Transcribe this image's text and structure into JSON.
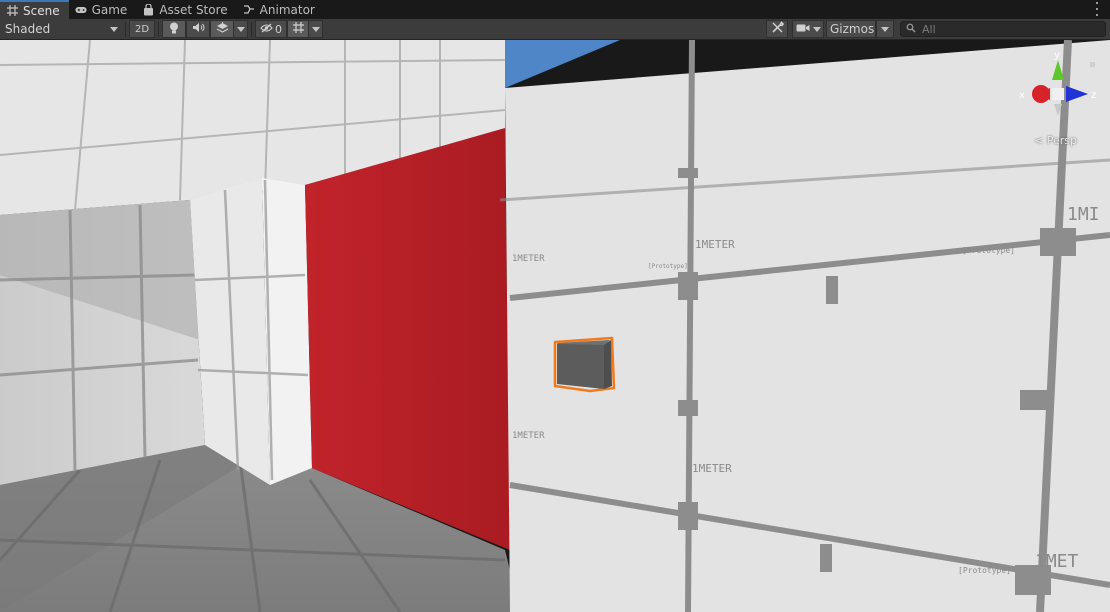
{
  "tabs": [
    {
      "label": "Scene",
      "icon": "grid-icon",
      "active": true
    },
    {
      "label": "Game",
      "icon": "gamepad-icon",
      "active": false
    },
    {
      "label": "Asset Store",
      "icon": "bag-icon",
      "active": false
    },
    {
      "label": "Animator",
      "icon": "animator-icon",
      "active": false
    }
  ],
  "toolbar": {
    "draw_mode": "Shaded",
    "mode_2d": "2D",
    "hidden_count": "0",
    "gizmos_label": "Gizmos",
    "search_placeholder": "All"
  },
  "gizmo": {
    "x_label": "x",
    "y_label": "y",
    "z_label": "z",
    "projection": "< Persp"
  },
  "colors": {
    "red_wall": "#b51e25",
    "selection_outline": "#f27a1c",
    "sky": "#4e86c7",
    "axis_x": "#d8222a",
    "axis_y": "#5ec82a",
    "axis_z": "#2233d6"
  },
  "scene_text": {
    "meter": "1METER",
    "prototype": "[Prototype]",
    "meter_cut": "1MET",
    "meter_cut2": "1MI"
  }
}
